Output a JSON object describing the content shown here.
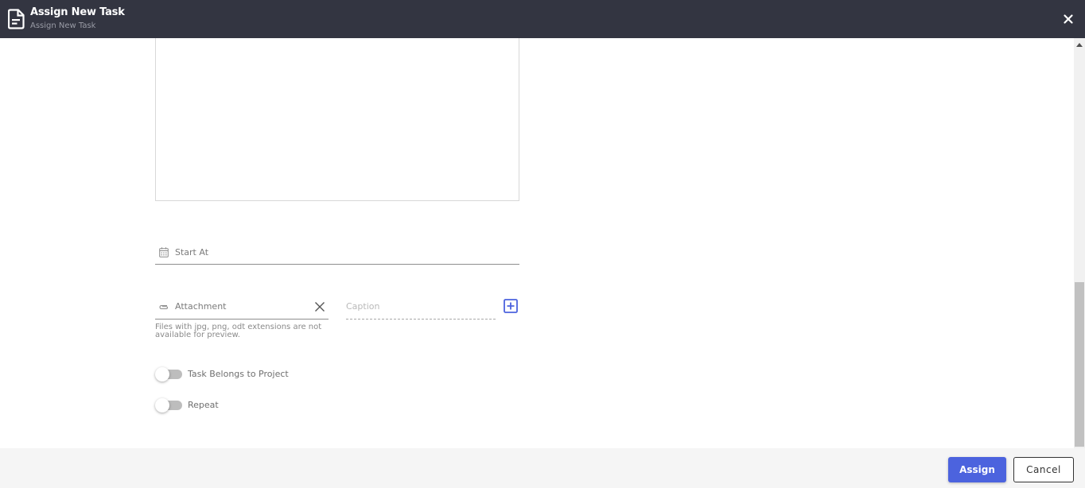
{
  "header": {
    "title": "Assign New Task",
    "subtitle": "Assign New Task",
    "icon": "document-icon",
    "close_icon": "close-icon"
  },
  "form": {
    "description_value": "",
    "start_at": {
      "label": "Start At",
      "icon": "calendar-icon",
      "value": ""
    },
    "attachment": {
      "label": "Attachment",
      "icon": "paperclip-icon",
      "clear_icon": "close-icon",
      "value": ""
    },
    "caption": {
      "placeholder": "Caption",
      "value": ""
    },
    "add_attachment_icon": "plus-square-icon",
    "helper_text": "Files with jpg, png, odt extensions are not available for preview.",
    "toggles": [
      {
        "label": "Task Belongs to Project",
        "checked": false
      },
      {
        "label": "Repeat",
        "checked": false
      }
    ]
  },
  "footer": {
    "assign_label": "Assign",
    "cancel_label": "Cancel"
  },
  "colors": {
    "header_bg": "#333541",
    "primary": "#4c63de",
    "footer_bg": "#f5f5f5"
  }
}
